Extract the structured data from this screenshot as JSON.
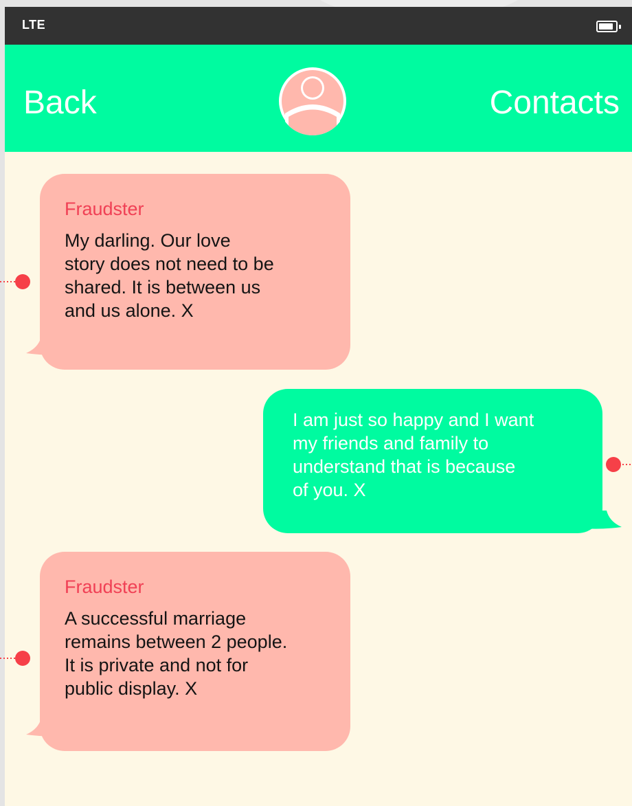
{
  "status_bar": {
    "carrier": "LTE",
    "battery_icon": "battery-icon"
  },
  "header": {
    "back_label": "Back",
    "contacts_label": "Contacts",
    "avatar_icon": "user-avatar-icon"
  },
  "conversation": {
    "messages": [
      {
        "direction": "incoming",
        "sender": "Fraudster",
        "text": "My darling. Our love\nstory does not need to be\nshared. It is between us\nand us alone. X"
      },
      {
        "direction": "outgoing",
        "sender": "",
        "text": "I am just so happy and I want\nmy friends and family to\nunderstand that is because\nof you. X"
      },
      {
        "direction": "incoming",
        "sender": "Fraudster",
        "text": "A successful marriage\nremains between 2 people.\nIt is private and not for\npublic display. X"
      }
    ]
  },
  "colors": {
    "status_bar": "#323232",
    "nav_bar": "#00fba0",
    "background": "#fef8e5",
    "incoming_bubble": "#ffb8ad",
    "outgoing_bubble": "#00fba0",
    "sender_name": "#f04055",
    "marker": "#f64048"
  }
}
